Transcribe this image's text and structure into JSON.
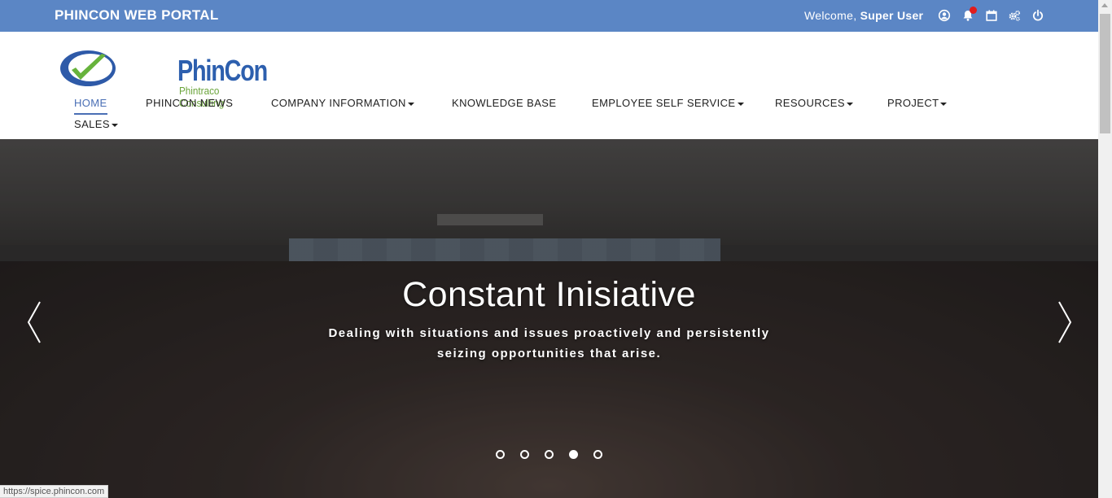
{
  "topbar": {
    "brand": "PHINCON WEB PORTAL",
    "welcome_prefix": "Welcome,",
    "user": "Super User",
    "icons": [
      "user-circle-icon",
      "bell-icon",
      "calendar-icon",
      "settings-gears-icon",
      "power-icon"
    ],
    "bg_color": "#5b86c5",
    "notification_color": "#e21c1c"
  },
  "logo": {
    "name": "PhinCon",
    "tagline": "Phintraco Consulting"
  },
  "nav": {
    "home": "HOME",
    "news": "PHINCON NEWS",
    "company": "COMPANY INFORMATION",
    "knowledge": "KNOWLEDGE BASE",
    "ess": "EMPLOYEE SELF SERVICE",
    "resources": "RESOURCES",
    "project": "PROJECT",
    "sales": "SALES",
    "active_color": "#4a6fb5"
  },
  "hero": {
    "title": "Constant Inisiative",
    "subtitle_line1": "Dealing with situations and issues proactively and persistently",
    "subtitle_line2": "seizing opportunities that arise.",
    "slide_count": 5,
    "active_slide": 4
  },
  "status_url": "https://spice.phincon.com"
}
